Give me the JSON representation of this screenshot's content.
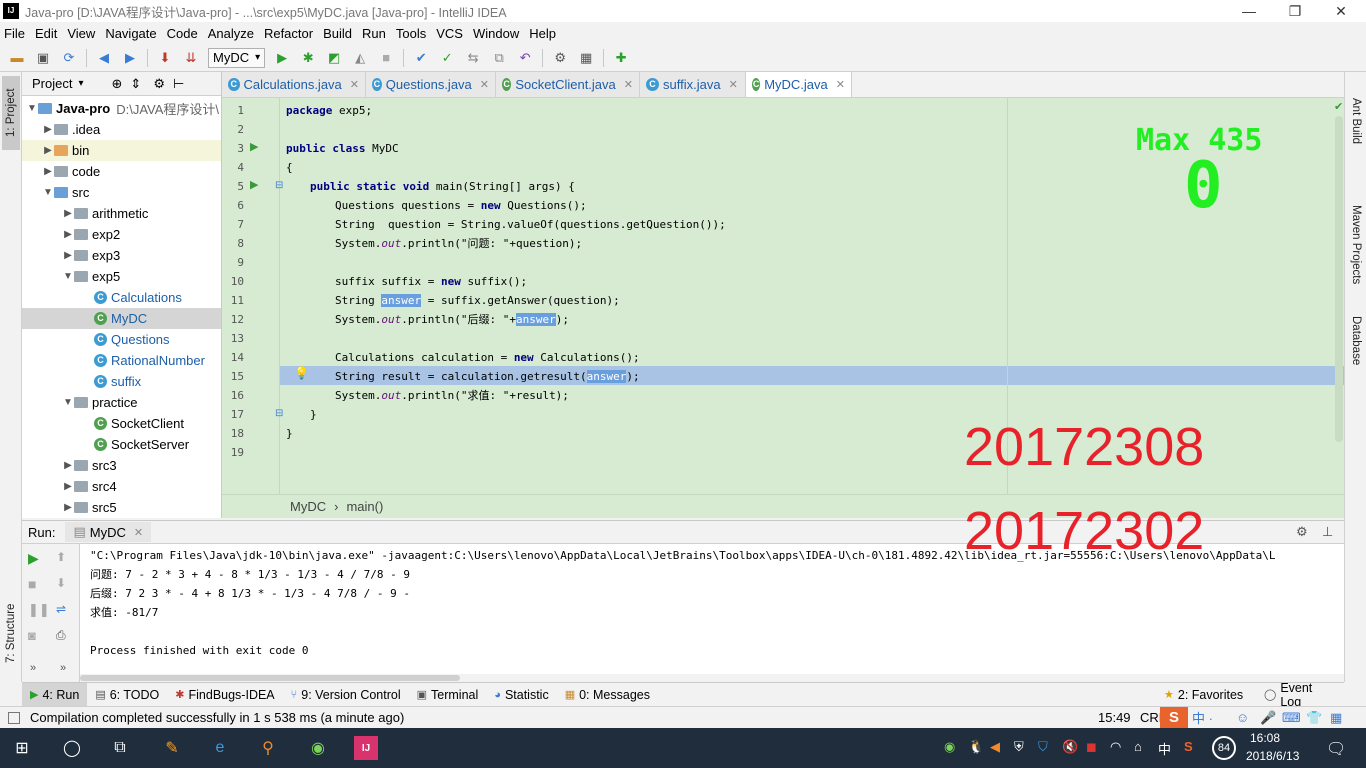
{
  "window": {
    "title": "Java-pro [D:\\JAVA程序设计\\Java-pro] - ...\\src\\exp5\\MyDC.java [Java-pro] - IntelliJ IDEA",
    "app_icon_text": "IJ",
    "minimize": "—",
    "maximize": "❐",
    "close": "✕"
  },
  "menu": [
    "File",
    "Edit",
    "View",
    "Navigate",
    "Code",
    "Analyze",
    "Refactor",
    "Build",
    "Run",
    "Tools",
    "VCS",
    "Window",
    "Help"
  ],
  "toolbar": {
    "run_config": "MyDC"
  },
  "left_strip": {
    "project_tab": "1: Project",
    "structure_tab": "7: Structure"
  },
  "project": {
    "header": "Project",
    "root_label": "Java-pro",
    "root_path": "D:\\JAVA程序设计\\",
    "items": [
      {
        "label": ".idea"
      },
      {
        "label": "bin"
      },
      {
        "label": "code"
      },
      {
        "label": "src"
      },
      {
        "label": "arithmetic"
      },
      {
        "label": "exp2"
      },
      {
        "label": "exp3"
      },
      {
        "label": "exp5"
      },
      {
        "label": "Calculations"
      },
      {
        "label": "MyDC"
      },
      {
        "label": "Questions"
      },
      {
        "label": "RationalNumber"
      },
      {
        "label": "suffix"
      },
      {
        "label": "practice"
      },
      {
        "label": "SocketClient"
      },
      {
        "label": "SocketServer"
      },
      {
        "label": "src3"
      },
      {
        "label": "src4"
      },
      {
        "label": "src5"
      }
    ]
  },
  "tabs": [
    {
      "label": "Calculations.java"
    },
    {
      "label": "Questions.java"
    },
    {
      "label": "SocketClient.java"
    },
    {
      "label": "suffix.java"
    },
    {
      "label": "MyDC.java"
    }
  ],
  "editor": {
    "line_numbers": [
      "1",
      "2",
      "3",
      "4",
      "5",
      "6",
      "7",
      "8",
      "9",
      "10",
      "11",
      "12",
      "13",
      "14",
      "15",
      "16",
      "17",
      "18",
      "19"
    ],
    "l1": {
      "kw": "package",
      "rest": " exp5;"
    },
    "l3": {
      "kw": "public class",
      "rest": " MyDC"
    },
    "l4": "{",
    "l5": {
      "kw": "public static void",
      "rest": " main(String[] args) {"
    },
    "l6": {
      "a": "Questions questions = ",
      "kw": "new",
      "b": " Questions();"
    },
    "l7": "String  question = String.valueOf(questions.getQuestion());",
    "l8": {
      "a": "System.",
      "it": "out",
      "b": ".println(\"问题: \"+question);"
    },
    "l10": {
      "a": "suffix suffix = ",
      "kw": "new",
      "b": " suffix();"
    },
    "l11": {
      "a": "String ",
      "hl": "answer",
      "b": " = suffix.getAnswer(question);"
    },
    "l12": {
      "a": "System.",
      "it": "out",
      "b": ".println(\"后缀: \"+",
      "hl": "answer",
      "c": ");"
    },
    "l14": {
      "a": "Calculations calculation = ",
      "kw": "new",
      "b": " Calculations();"
    },
    "l15": {
      "a": "String result = calculation.getresult(",
      "hl": "answer",
      "b": ");"
    },
    "l16": {
      "a": "System.",
      "it": "out",
      "b": ".println(\"求值: \"+result);"
    },
    "l17": "}",
    "l18": "}"
  },
  "breadcrumb": {
    "a": "MyDC",
    "sep": "›",
    "b": "main()"
  },
  "right_strip": {
    "ant": "Ant Build",
    "maven": "Maven Projects",
    "database": "Database"
  },
  "run": {
    "label": "Run:",
    "config": "MyDC",
    "console": [
      "\"C:\\Program Files\\Java\\jdk-10\\bin\\java.exe\" -javaagent:C:\\Users\\lenovo\\AppData\\Local\\JetBrains\\Toolbox\\apps\\IDEA-U\\ch-0\\181.4892.42\\lib\\idea_rt.jar=55556:C:\\Users\\lenovo\\AppData\\L",
      "问题: 7 - 2 * 3 + 4 - 8 * 1/3 - 1/3 - 4 / 7/8 - 9",
      "后缀: 7 2 3 * - 4 + 8 1/3 * - 1/3 - 4 7/8 / - 9 -",
      "求值: -81/7",
      "",
      "Process finished with exit code 0"
    ]
  },
  "bottom_tabs": [
    {
      "label": "4: Run"
    },
    {
      "label": "6: TODO"
    },
    {
      "label": "FindBugs-IDEA"
    },
    {
      "label": "9: Version Control"
    },
    {
      "label": "Terminal"
    },
    {
      "label": "Statistic"
    },
    {
      "label": "0: Messages"
    },
    {
      "label": "2: Favorites"
    },
    {
      "label": "Event Log"
    }
  ],
  "status": {
    "message": "Compilation completed successfully in 1 s 538 ms (a minute ago)",
    "position": "15:49",
    "encoding": "CRL"
  },
  "overlay": {
    "max_text": "Max 435",
    "score": "0",
    "id1": "20172308",
    "id2": "20172302"
  },
  "taskbar": {
    "time": "16:08",
    "date": "2018/6/13",
    "ime": "中",
    "badge": "84"
  },
  "colors": {
    "editor_bg": "#d6ebd2",
    "overlay_red": "#e8222a",
    "overlay_green": "#22ee22",
    "taskbar_bg": "#1f2d3d"
  }
}
